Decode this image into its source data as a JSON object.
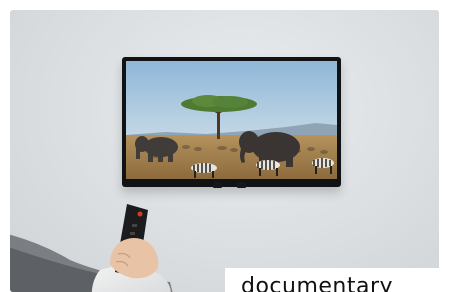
{
  "caption": {
    "text": "documentary"
  },
  "scene": {
    "wall_color": "#dfe2e5",
    "tv_frame_color": "#111214",
    "sky_color": "#9fc2dd",
    "grass_color": "#b08a52"
  }
}
